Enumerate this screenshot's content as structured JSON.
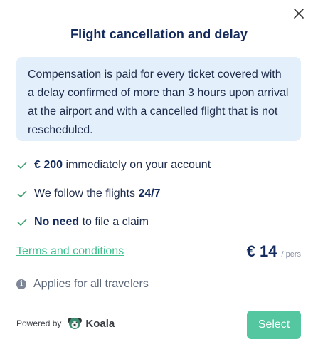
{
  "dialog": {
    "title": "Flight cancellation and delay",
    "description": "Compensation is paid for every ticket covered with a delay confirmed of more than 3 hours upon arrival at the airport and with a cancelled flight that is not rescheduled."
  },
  "features": [
    {
      "bold": "€ 200",
      "text": " immediately on your account"
    },
    {
      "text": "We follow the flights ",
      "bold": "24/7"
    },
    {
      "bold": "No need",
      "text": " to file a claim"
    }
  ],
  "terms_label": "Terms and conditions",
  "price": {
    "amount": "€ 14",
    "unit": "/ pers"
  },
  "applies_text": "Applies for all travelers",
  "footer": {
    "powered_by": "Powered by",
    "brand": "Koala",
    "select_label": "Select"
  },
  "colors": {
    "accent": "#54c7a0",
    "link": "#3fbf8e",
    "info_bg": "#e3effa",
    "title": "#132a5c"
  }
}
